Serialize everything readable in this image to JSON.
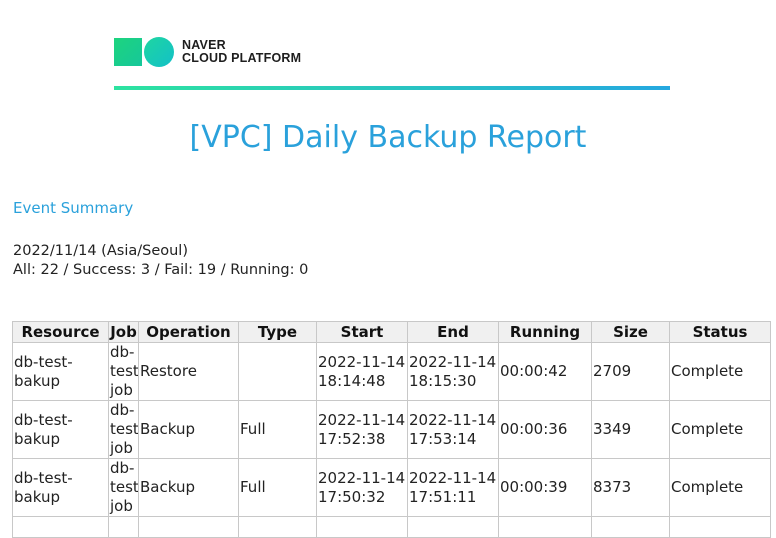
{
  "brand": {
    "line1": "NAVER",
    "line2": "CLOUD PLATFORM",
    "colors": {
      "green": "#1dd47e",
      "teal": "#13c0c8",
      "accent": "#2aa1db"
    }
  },
  "report": {
    "title": "[VPC] Daily Backup Report",
    "summary_label": "Event Summary",
    "date": "2022/11/14 (Asia/Seoul)",
    "counts": "All: 22 / Success: 3 / Fail: 19 / Running: 0"
  },
  "table": {
    "headers": [
      "Resource",
      "Job",
      "Operation",
      "Type",
      "Start",
      "End",
      "Running",
      "Size",
      "Status"
    ],
    "rows": [
      {
        "resource": "db-test-bakup",
        "job": "db-test-job",
        "operation": "Restore",
        "type": "",
        "start": "2022-11-14 18:14:48",
        "end": "2022-11-14 18:15:30",
        "running": "00:00:42",
        "size": "2709",
        "status": "Complete"
      },
      {
        "resource": "db-test-bakup",
        "job": "db-test-job",
        "operation": "Backup",
        "type": "Full",
        "start": "2022-11-14 17:52:38",
        "end": "2022-11-14 17:53:14",
        "running": "00:00:36",
        "size": "3349",
        "status": "Complete"
      },
      {
        "resource": "db-test-bakup",
        "job": "db-test-job",
        "operation": "Backup",
        "type": "Full",
        "start": "2022-11-14 17:50:32",
        "end": "2022-11-14 17:51:11",
        "running": "00:00:39",
        "size": "8373",
        "status": "Complete"
      }
    ]
  }
}
